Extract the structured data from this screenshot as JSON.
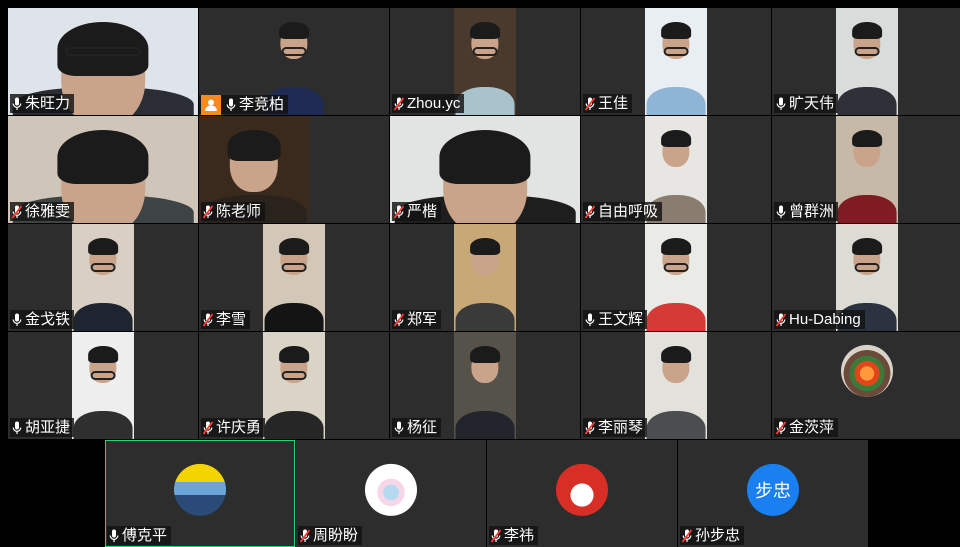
{
  "colors": {
    "tile_bg": "#2d2d2d",
    "active_border": "#23d96a",
    "host_badge": "#f58b1f",
    "muted_mic": "#ff3b30",
    "avatar_bu_zhong": "#1a7ff0"
  },
  "participants": [
    {
      "name": "朱旺力",
      "mic": "on",
      "bg": "#dfe4ea",
      "shirt": "#2a2d34",
      "glasses": true
    },
    {
      "name": "李竞柏",
      "mic": "on",
      "host": true,
      "bg": "#2d2d2d",
      "shirt": "#1f2b52",
      "glasses": true
    },
    {
      "name": "Zhou.yc",
      "mic": "muted",
      "bg": "#4a3a2e",
      "shirt": "#a9c3cc",
      "glasses": true
    },
    {
      "name": "王佳",
      "mic": "muted",
      "bg": "#e9eef3",
      "shirt": "#8fb5d6",
      "glasses": true
    },
    {
      "name": "旷天伟",
      "mic": "on",
      "bg": "#d8dcda",
      "shirt": "#2f3038",
      "glasses": true
    },
    {
      "name": "徐雅雯",
      "mic": "muted",
      "bg": "#cfc5b8",
      "shirt": "#3e4446",
      "glasses": false
    },
    {
      "name": "陈老师",
      "mic": "muted",
      "bg": "#3a2a1e",
      "shirt": "#2a231c",
      "glasses": false
    },
    {
      "name": "严楷",
      "mic": "muted",
      "bg": "#e2e4e4",
      "shirt": "#1e1e1e",
      "glasses": false
    },
    {
      "name": "自由呼吸",
      "mic": "muted",
      "bg": "#e8e6e2",
      "shirt": "#8a7c6e",
      "glasses": false
    },
    {
      "name": "曾群洲",
      "mic": "on",
      "bg": "#c7b9a8",
      "shirt": "#7e1c22",
      "glasses": false
    },
    {
      "name": "金戈铁",
      "mic": "on",
      "bg": "#d9cfc4",
      "shirt": "#1e2530",
      "glasses": true
    },
    {
      "name": "李雪",
      "mic": "muted",
      "bg": "#d3c7b8",
      "shirt": "#141414",
      "glasses": true
    },
    {
      "name": "郑军",
      "mic": "muted",
      "bg": "#c9a878",
      "shirt": "#3a3a3a",
      "glasses": false
    },
    {
      "name": "王文辉",
      "mic": "on",
      "bg": "#eaeae6",
      "shirt": "#d63a36",
      "glasses": true
    },
    {
      "name": "Hu-Dabing",
      "mic": "muted",
      "bg": "#dcdcd4",
      "shirt": "#2c3340",
      "glasses": true
    },
    {
      "name": "胡亚捷",
      "mic": "on",
      "bg": "#eeeeee",
      "shirt": "#2f2f2f",
      "glasses": true
    },
    {
      "name": "许庆勇",
      "mic": "muted",
      "bg": "#d9d4c6",
      "shirt": "#262626",
      "glasses": true
    },
    {
      "name": "杨征",
      "mic": "on",
      "bg": "#55524a",
      "shirt": "#22262c",
      "glasses": false
    },
    {
      "name": "李丽琴",
      "mic": "muted",
      "bg": "#e3e1dc",
      "shirt": "#4b4e50",
      "glasses": false
    },
    {
      "name": "金茨萍",
      "mic": "muted",
      "avatar": "flower"
    },
    {
      "name": "傅克平",
      "mic": "on",
      "avatar": "photo",
      "active": true
    },
    {
      "name": "周盼盼",
      "mic": "muted",
      "avatar": "cartoon"
    },
    {
      "name": "李祎",
      "mic": "muted",
      "avatar": "face"
    },
    {
      "name": "孙步忠",
      "mic": "muted",
      "avatar": "text",
      "avatar_text": "步忠"
    }
  ]
}
